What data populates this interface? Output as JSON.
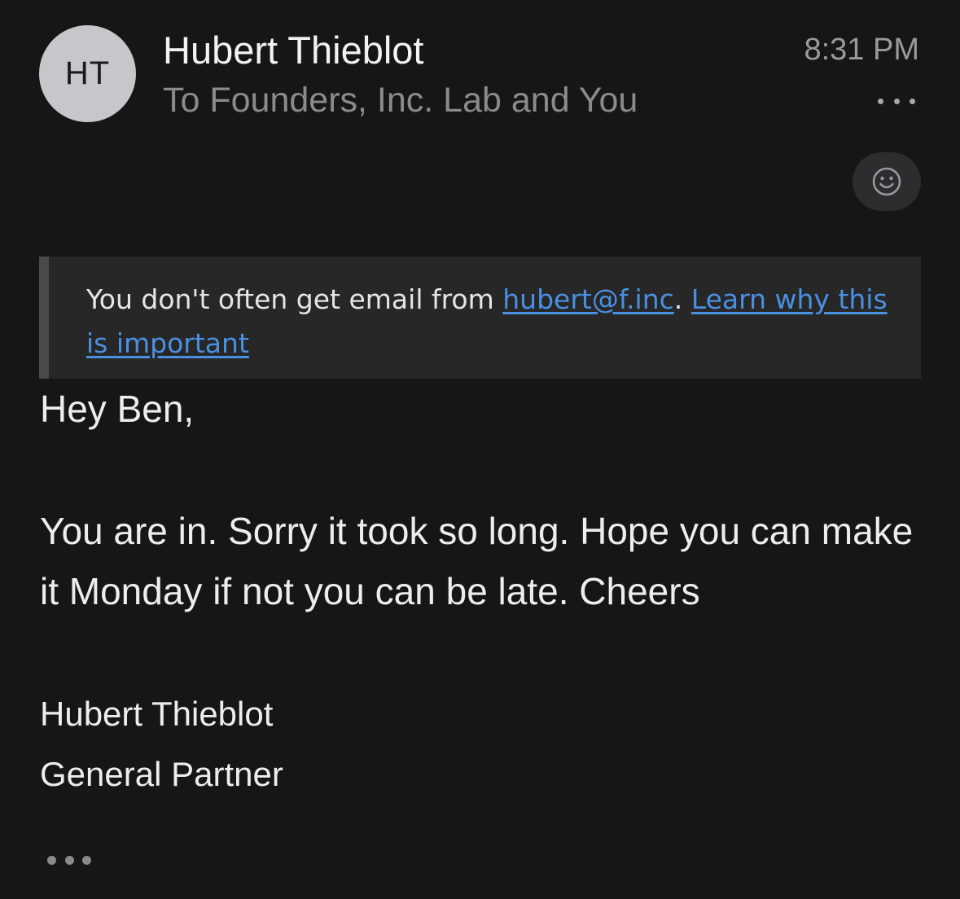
{
  "header": {
    "avatar_initials": "HT",
    "sender_name": "Hubert Thieblot",
    "recipients": "To Founders, Inc. Lab and You",
    "time": "8:31 PM",
    "more_icon": "ellipsis-icon",
    "reaction_icon": "smiley-icon"
  },
  "notice": {
    "text_before": "You don't often get email from ",
    "sender_email": "hubert@f.inc",
    "separator": ". ",
    "learn_link": "Learn why this is important"
  },
  "message": {
    "greeting": "Hey Ben,",
    "body": "You are in. Sorry it took so long. Hope you can make it Monday if not you can be late. Cheers",
    "signature_name": "Hubert Thieblot",
    "signature_title": "General Partner",
    "expand_icon": "ellipsis-icon"
  },
  "colors": {
    "background": "#161616",
    "link": "#4a90e2",
    "notice_background": "#272727",
    "avatar": "#c7c6cb"
  }
}
